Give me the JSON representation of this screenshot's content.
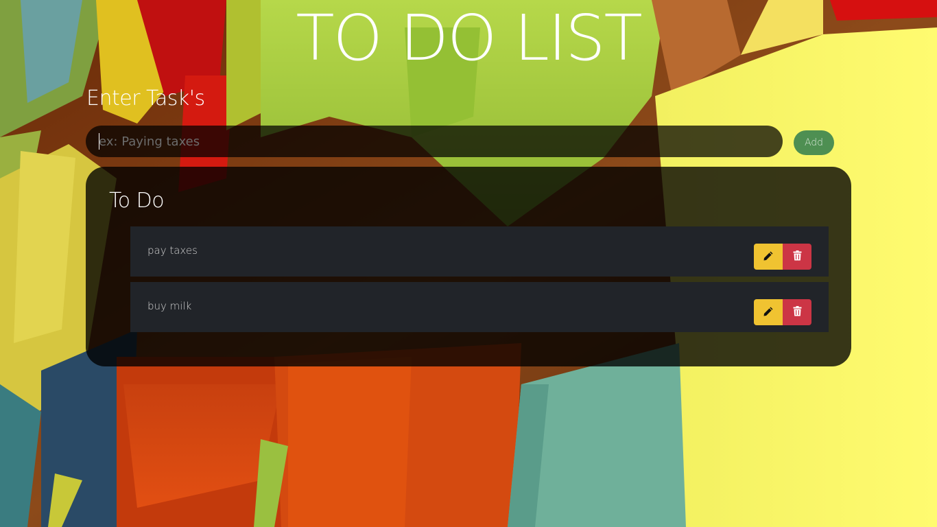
{
  "app": {
    "title": "TO DO LIST"
  },
  "entry": {
    "label": "Enter Task's",
    "placeholder": "ex: Paying taxes",
    "value": "",
    "add_label": "Add"
  },
  "todo": {
    "heading": "To Do",
    "items": [
      {
        "text": "pay taxes",
        "edit_icon": "pencil-icon",
        "delete_icon": "trash-icon"
      },
      {
        "text": "buy milk",
        "edit_icon": "pencil-icon",
        "delete_icon": "trash-icon"
      }
    ]
  },
  "colors": {
    "add_button": "#4e8f52",
    "edit_button": "#f0c331",
    "delete_button": "#cc3545",
    "row_background": "#212429"
  }
}
